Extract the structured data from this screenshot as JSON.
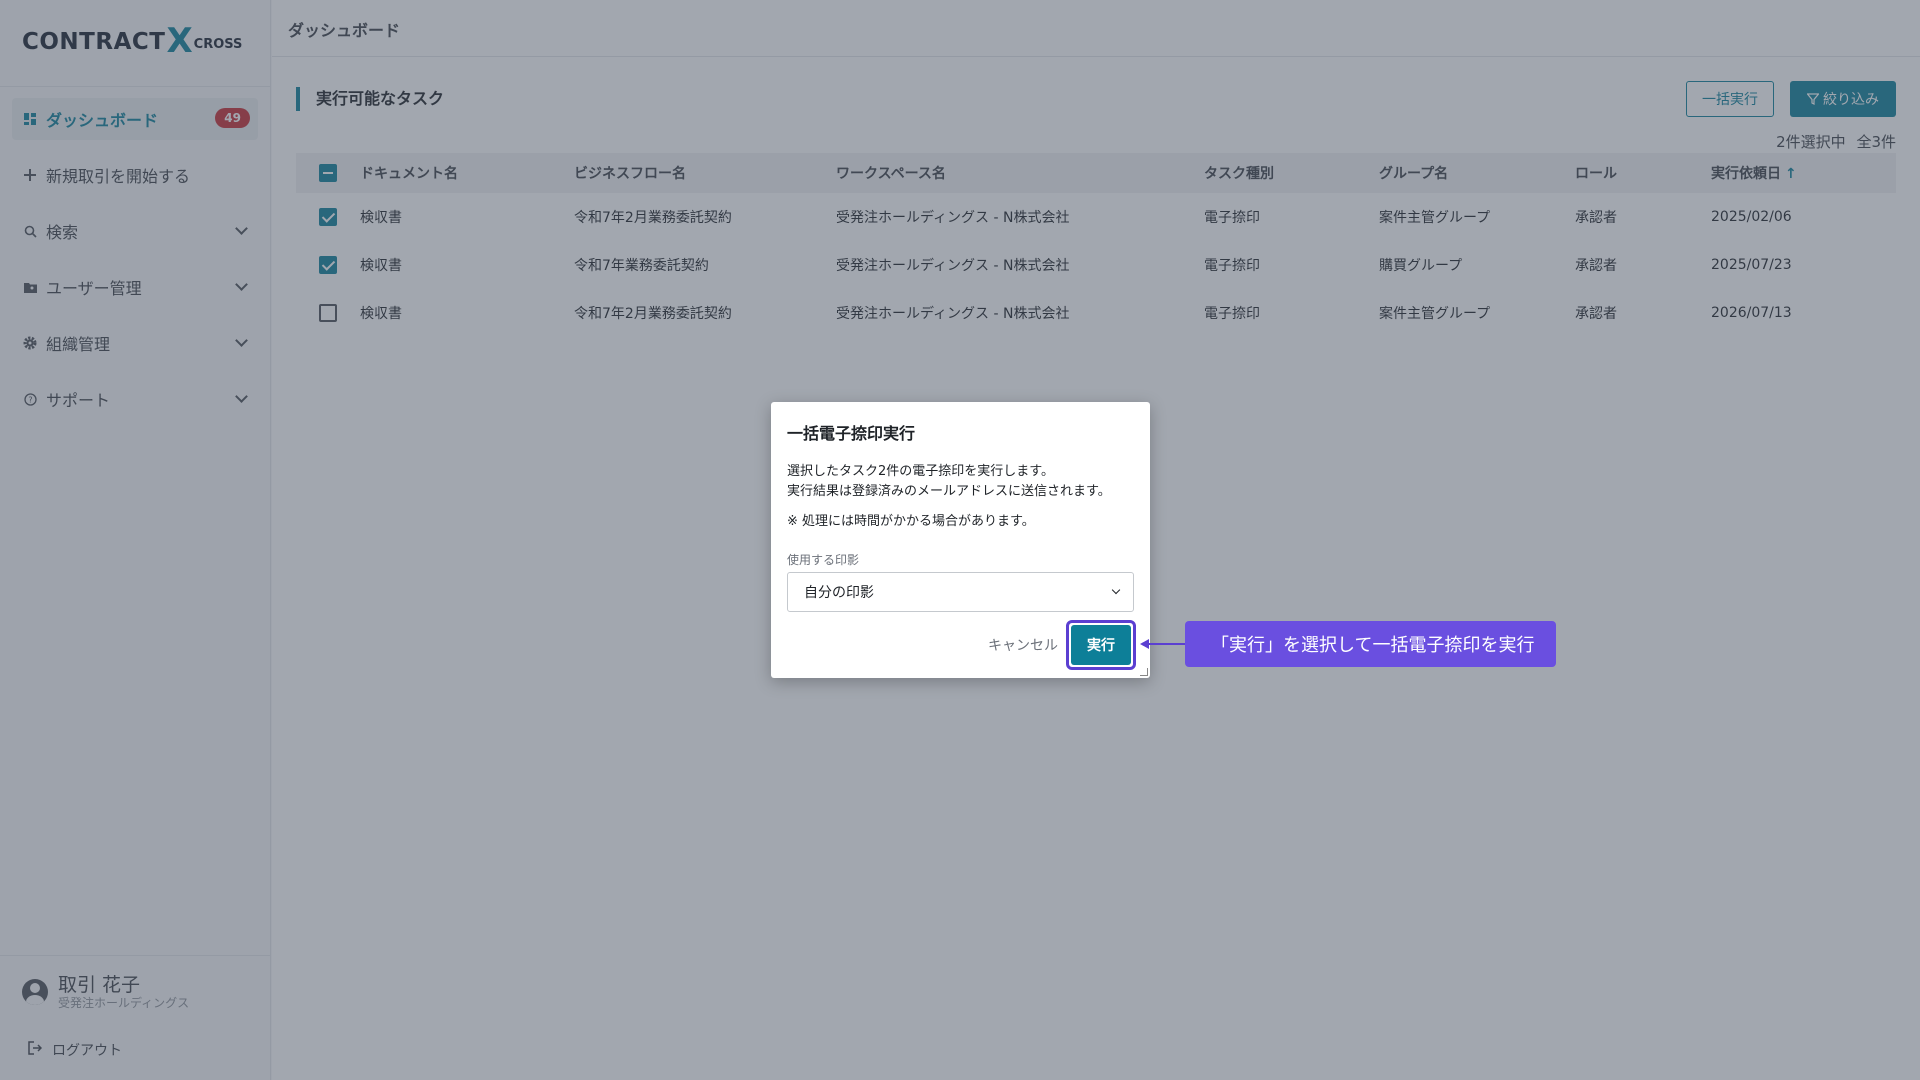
{
  "logo": {
    "main": "CONTRACT",
    "x": "X",
    "cross": "CROSS"
  },
  "sidebar": {
    "items": [
      {
        "label": "ダッシュボード",
        "badge": "49"
      },
      {
        "label": "新規取引を開始する"
      },
      {
        "label": "検索"
      },
      {
        "label": "ユーザー管理"
      },
      {
        "label": "組織管理"
      },
      {
        "label": "サポート"
      }
    ]
  },
  "user": {
    "name": "取引 花子",
    "org": "受発注ホールディングス",
    "logout": "ログアウト"
  },
  "header": {
    "title": "ダッシュボード"
  },
  "section": {
    "title": "実行可能なタスク",
    "bulk_button": "一括実行",
    "filter_button": "絞り込み",
    "selection": "2件選択中",
    "total": "全3件"
  },
  "table": {
    "columns": [
      "ドキュメント名",
      "ビジネスフロー名",
      "ワークスペース名",
      "タスク種別",
      "グループ名",
      "ロール",
      "実行依頼日"
    ],
    "rows": [
      {
        "checked": true,
        "cells": [
          "検収書",
          "令和7年2月業務委託契約",
          "受発注ホールディングス - N株式会社",
          "電子捺印",
          "案件主管グループ",
          "承認者",
          "2025/02/06"
        ]
      },
      {
        "checked": true,
        "cells": [
          "検収書",
          "令和7年業務委託契約",
          "受発注ホールディングス - N株式会社",
          "電子捺印",
          "購買グループ",
          "承認者",
          "2025/07/23"
        ]
      },
      {
        "checked": false,
        "cells": [
          "検収書",
          "令和7年2月業務委託契約",
          "受発注ホールディングス - N株式会社",
          "電子捺印",
          "案件主管グループ",
          "承認者",
          "2026/07/13"
        ]
      }
    ]
  },
  "modal": {
    "title": "一括電子捺印実行",
    "line1": "選択したタスク2件の電子捺印を実行します。",
    "line2": "実行結果は登録済みのメールアドレスに送信されます。",
    "note": "※ 処理には時間がかかる場合があります。",
    "field_label": "使用する印影",
    "select_value": "自分の印影",
    "cancel": "キャンセル",
    "execute": "実行"
  },
  "callout": {
    "text": "「実行」を選択して一括電子捺印を実行"
  },
  "colors": {
    "accent": "#0d7f98",
    "badge": "#c62c32",
    "callout": "#6a4fe0"
  }
}
